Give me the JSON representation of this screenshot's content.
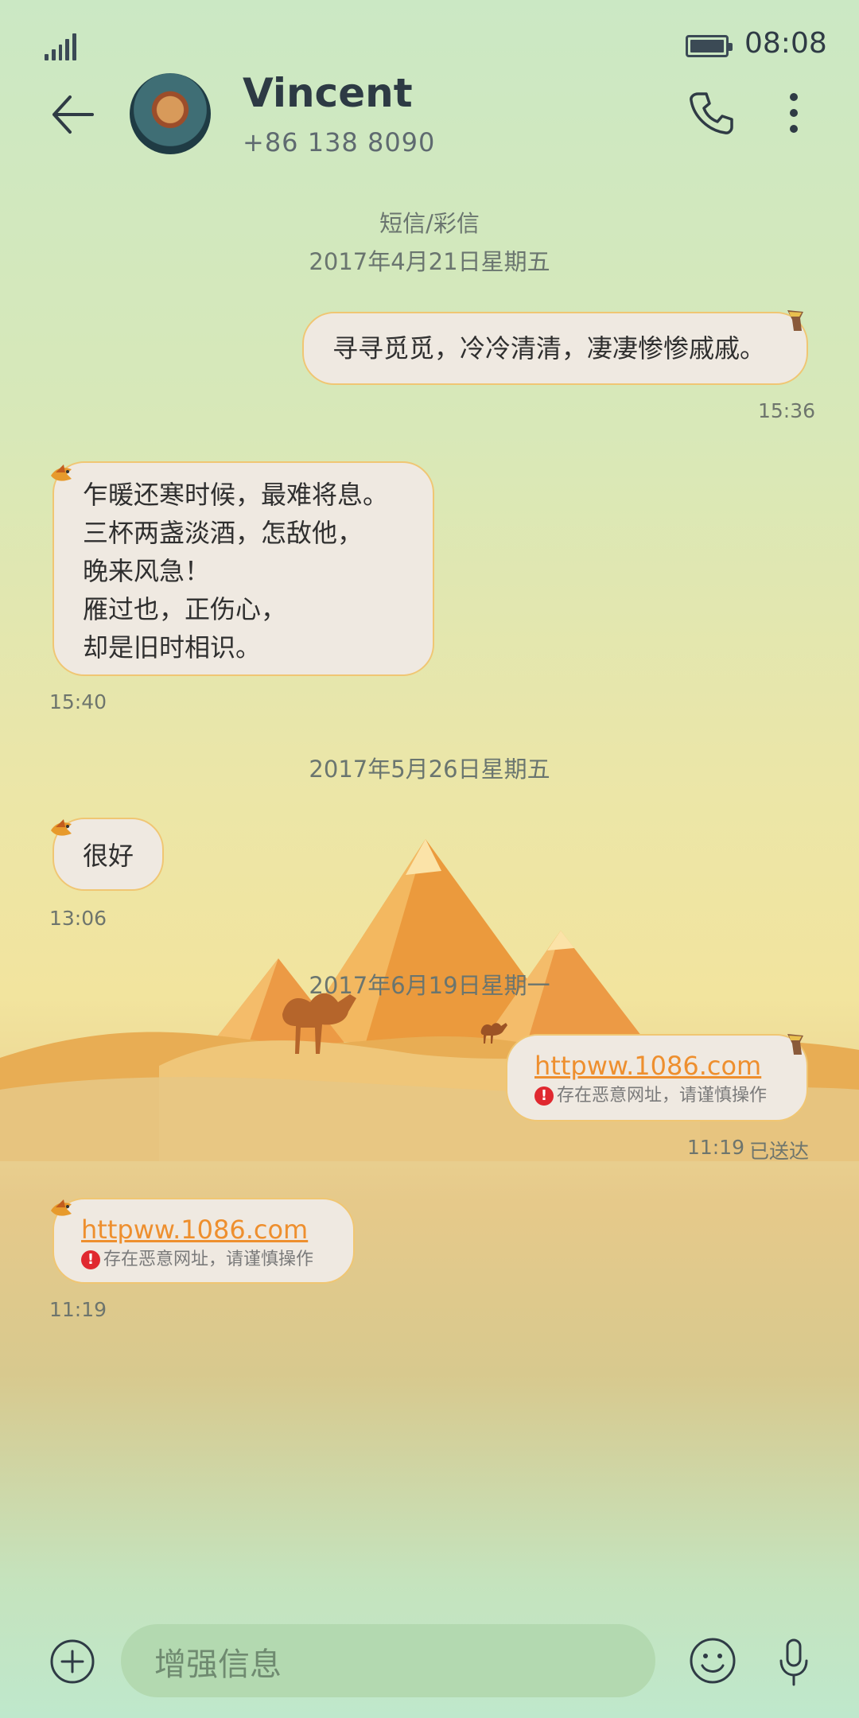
{
  "status": {
    "time": "08:08"
  },
  "header": {
    "name": "Vincent",
    "phone": "+86 138 8090"
  },
  "thread": {
    "type_label": "短信/彩信",
    "dates": [
      "2017年4月21日星期五",
      "2017年5月26日星期五",
      "2017年6月19日星期一"
    ]
  },
  "messages": [
    {
      "direction": "out",
      "text": "寻寻觅觅，冷冷清清，凄凄惨惨戚戚。",
      "time": "15:36"
    },
    {
      "direction": "in",
      "lines": [
        "乍暖还寒时候，最难将息。",
        "三杯两盏淡酒，怎敌他，",
        "晚来风急！",
        "雁过也，正伤心，",
        "却是旧时相识。"
      ],
      "time": "15:40"
    },
    {
      "direction": "in",
      "text": "很好",
      "time": "13:06"
    },
    {
      "direction": "out",
      "link": "httpww.1086.com",
      "warning": "存在恶意网址，请谨慎操作",
      "time": "11:19",
      "status": "已送达"
    },
    {
      "direction": "in",
      "link": "httpww.1086.com",
      "warning": "存在恶意网址，请谨慎操作",
      "time": "11:19"
    }
  ],
  "composer": {
    "placeholder": "增强信息"
  },
  "colors": {
    "bubble_border": "#f0c673",
    "link": "#ee8f2e",
    "warning": "#e0282f"
  }
}
